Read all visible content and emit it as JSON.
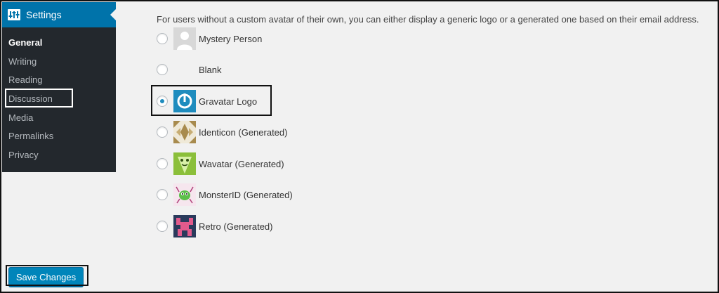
{
  "sidebar": {
    "header": {
      "icon": "settings-icon",
      "label": "Settings"
    },
    "items": [
      {
        "label": "General",
        "current": true
      },
      {
        "label": "Writing"
      },
      {
        "label": "Reading"
      },
      {
        "label": "Discussion"
      },
      {
        "label": "Media"
      },
      {
        "label": "Permalinks"
      },
      {
        "label": "Privacy"
      }
    ]
  },
  "main": {
    "default_avatar_description": "For users without a custom avatar of their own, you can either display a generic logo or a generated one based on their email address.",
    "avatar_options": [
      {
        "label": "Mystery Person",
        "icon": "mystery-person-avatar",
        "checked": false
      },
      {
        "label": "Blank",
        "icon": "blank-avatar",
        "checked": false
      },
      {
        "label": "Gravatar Logo",
        "icon": "gravatar-logo-avatar",
        "checked": true
      },
      {
        "label": "Identicon (Generated)",
        "icon": "identicon-avatar",
        "checked": false
      },
      {
        "label": "Wavatar (Generated)",
        "icon": "wavatar-avatar",
        "checked": false
      },
      {
        "label": "MonsterID (Generated)",
        "icon": "monsterid-avatar",
        "checked": false
      },
      {
        "label": "Retro (Generated)",
        "icon": "retro-avatar",
        "checked": false
      }
    ]
  },
  "footer": {
    "save_label": "Save Changes"
  },
  "colors": {
    "accent": "#0073aa",
    "sidebar_bg": "#23282d",
    "button": "#0085ba"
  }
}
